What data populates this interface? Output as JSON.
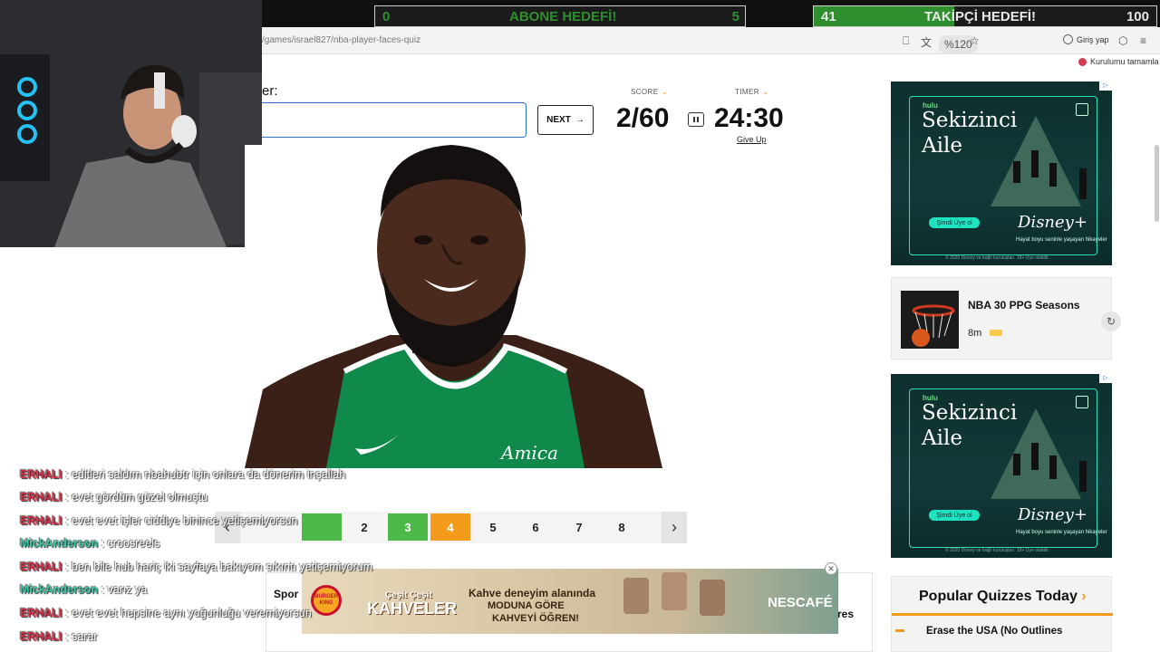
{
  "stream": {
    "goal_subs": {
      "label": "ABONE HEDEFİ!",
      "current": "0",
      "target": "5",
      "fraction": 0.0
    },
    "goal_follows": {
      "label": "TAKİPÇİ HEDEFİ!",
      "current": "41",
      "target": "100",
      "fraction": 0.41
    }
  },
  "browser": {
    "url": "/games/israel827/nba-player-faces-quiz",
    "zoom": "%120",
    "sign_in": "Giriş yap",
    "setup": "Kurulumu tamamla"
  },
  "quiz": {
    "answer_label": "er:",
    "answer_value": "",
    "next_label": "NEXT",
    "score_label": "SCORE",
    "score_value": "2/60",
    "timer_label": "TIMER",
    "timer_value": "24:30",
    "give_up": "Give Up",
    "pages": [
      {
        "label": "",
        "state": "correct"
      },
      {
        "label": "2",
        "state": "normal"
      },
      {
        "label": "3",
        "state": "correct"
      },
      {
        "label": "4",
        "state": "current"
      },
      {
        "label": "5",
        "state": "normal"
      },
      {
        "label": "6",
        "state": "normal"
      },
      {
        "label": "7",
        "state": "normal"
      },
      {
        "label": "8",
        "state": "normal"
      }
    ]
  },
  "chat": [
    {
      "user": "ERHALI",
      "color": "#e0304a",
      "message": " : editleri saldım nbahubtr için onlara da dönerim inşallah"
    },
    {
      "user": "ERHALI",
      "color": "#e0304a",
      "message": " : evet gördüm güzel olmuştu"
    },
    {
      "user": "ERHALI",
      "color": "#e0304a",
      "message": " : evet evet işler ciddiye binince yetişemiyorsun"
    },
    {
      "user": "MickAnderson",
      "color": "#3fc9a8",
      "message": " : croosreels"
    },
    {
      "user": "ERHALI",
      "color": "#e0304a",
      "message": " : ben bile hub hariç iki sayfaya bakıyom sıkıntı yetişemiyorum"
    },
    {
      "user": "MickAnderson",
      "color": "#3fc9a8",
      "message": " : varız ya"
    },
    {
      "user": "ERHALI",
      "color": "#e0304a",
      "message": " : evet evet hepsine aynı yoğunluğu veremiyorsun"
    },
    {
      "user": "ERHALI",
      "color": "#e0304a",
      "message": " : sarar"
    }
  ],
  "sidebar": {
    "ad_top": {
      "brand": "hulu",
      "title_line1": "Sekizinci",
      "title_line2": "Aile",
      "cta": "Şimdi Üye ol",
      "logo": "Disney+",
      "tagline": "Hayat boyu seninle yaşayan hikayeler",
      "fine_print": "© 2025 Disney ve bağlı kuruluşları. 18+ Üye olabilir."
    },
    "related": {
      "title": "NBA 30 PPG Seasons",
      "time": "8m"
    },
    "ad_bottom": {
      "brand": "hulu",
      "title_line1": "Sekizinci",
      "title_line2": "Aile",
      "cta": "Şimdi Üye ol",
      "logo": "Disney+",
      "tagline": "Hayat boyu seninle yaşayan hikayeler",
      "fine_print": "© 2025 Disney ve bağlı kuruluşları. 18+ Üye olabilir."
    },
    "popular": {
      "heading": "Popular Quizzes Today",
      "first_item": "Erase the USA (No Outlines"
    }
  },
  "bottom": {
    "left_label": "Spor",
    "right_label": "res"
  },
  "banner": {
    "bk_text": "BURGER KING",
    "line1": "Çeşit Çeşit",
    "line2": "KAHVELER",
    "headline1": "Kahve deneyim alanında",
    "headline2": "MODUNA GÖRE",
    "headline3": "KAHVEYİ ÖĞREN!",
    "brand": "NESCAFÉ"
  },
  "colors": {
    "accent_orange": "#f39b1b",
    "correct_green": "#4cb848",
    "input_blue": "#2d6fd2"
  }
}
